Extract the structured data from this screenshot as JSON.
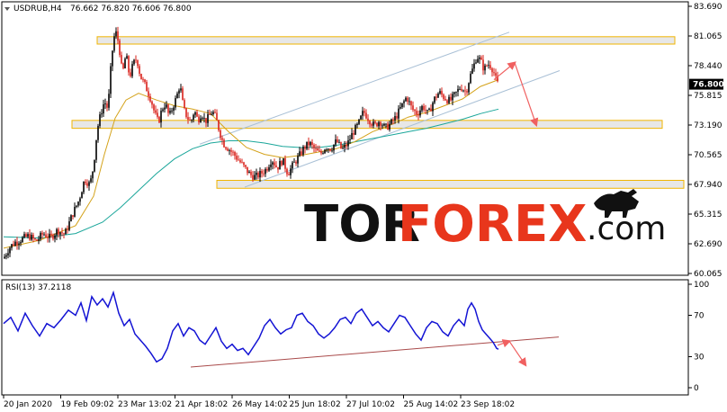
{
  "chart_data": [
    {
      "type": "candlestick",
      "title": "USDRUB,H4  76.662 76.820 76.606 76.800",
      "symbol": "USDRUB,H4",
      "ohlc_header": "76.662 76.820 76.606 76.800",
      "last_price_label": "76.800",
      "ylim": [
        60.065,
        83.69
      ],
      "y_ticks": [
        "83.690",
        "81.065",
        "78.440",
        "75.815",
        "73.190",
        "70.565",
        "67.940",
        "65.315",
        "62.690",
        "60.065"
      ],
      "x_tick_labels": [
        "20 Jan 2020",
        "19 Feb 09:02",
        "23 Mar 13:02",
        "21 Apr 18:02",
        "26 May 14:02",
        "25 Jun 18:02",
        "27 Jul 10:02",
        "25 Aug 14:02",
        "23 Sep 18:02"
      ],
      "close_path": [
        [
          0,
          61.4
        ],
        [
          6,
          62.3
        ],
        [
          12,
          62.8
        ],
        [
          20,
          63.1
        ],
        [
          28,
          63.4
        ],
        [
          36,
          62.9
        ],
        [
          44,
          63.6
        ],
        [
          52,
          63.2
        ],
        [
          60,
          63.9
        ],
        [
          68,
          63.5
        ],
        [
          76,
          65.2
        ],
        [
          84,
          66.6
        ],
        [
          90,
          68.4
        ],
        [
          96,
          67.9
        ],
        [
          100,
          69.6
        ],
        [
          104,
          72.8
        ],
        [
          108,
          74.2
        ],
        [
          112,
          75.3
        ],
        [
          116,
          74.6
        ],
        [
          120,
          79.2
        ],
        [
          124,
          81.6
        ],
        [
          128,
          80.4
        ],
        [
          132,
          77.6
        ],
        [
          136,
          79.5
        ],
        [
          140,
          77.4
        ],
        [
          144,
          78.6
        ],
        [
          148,
          79.1
        ],
        [
          152,
          77.5
        ],
        [
          156,
          76.9
        ],
        [
          160,
          76.2
        ],
        [
          164,
          75.4
        ],
        [
          168,
          74.2
        ],
        [
          172,
          73.4
        ],
        [
          176,
          74.6
        ],
        [
          180,
          75.1
        ],
        [
          184,
          73.9
        ],
        [
          188,
          74.8
        ],
        [
          192,
          75.6
        ],
        [
          196,
          76.8
        ],
        [
          200,
          74.6
        ],
        [
          204,
          73.9
        ],
        [
          208,
          73.4
        ],
        [
          212,
          74.5
        ],
        [
          216,
          73.6
        ],
        [
          220,
          74.3
        ],
        [
          224,
          73.5
        ],
        [
          228,
          73.9
        ],
        [
          232,
          74.4
        ],
        [
          236,
          73.8
        ],
        [
          240,
          72.6
        ],
        [
          244,
          71.6
        ],
        [
          250,
          71.1
        ],
        [
          256,
          70.6
        ],
        [
          262,
          70.0
        ],
        [
          268,
          69.4
        ],
        [
          274,
          68.8
        ],
        [
          280,
          68.6
        ],
        [
          286,
          68.9
        ],
        [
          292,
          69.3
        ],
        [
          298,
          70.2
        ],
        [
          304,
          69.4
        ],
        [
          310,
          70.1
        ],
        [
          316,
          68.9
        ],
        [
          322,
          69.7
        ],
        [
          328,
          70.4
        ],
        [
          334,
          71.2
        ],
        [
          340,
          71.6
        ],
        [
          346,
          71.0
        ],
        [
          352,
          70.6
        ],
        [
          358,
          71.3
        ],
        [
          364,
          71.1
        ],
        [
          370,
          71.8
        ],
        [
          376,
          71.0
        ],
        [
          382,
          71.5
        ],
        [
          388,
          72.5
        ],
        [
          394,
          73.2
        ],
        [
          400,
          74.4
        ],
        [
          406,
          73.7
        ],
        [
          412,
          73.1
        ],
        [
          418,
          73.6
        ],
        [
          424,
          72.9
        ],
        [
          430,
          73.3
        ],
        [
          436,
          73.9
        ],
        [
          442,
          74.8
        ],
        [
          448,
          75.7
        ],
        [
          454,
          74.6
        ],
        [
          460,
          74.2
        ],
        [
          466,
          74.9
        ],
        [
          472,
          74.1
        ],
        [
          478,
          75.4
        ],
        [
          484,
          76.1
        ],
        [
          490,
          75.6
        ],
        [
          496,
          75.3
        ],
        [
          502,
          75.9
        ],
        [
          508,
          76.6
        ],
        [
          514,
          76.1
        ],
        [
          518,
          77.4
        ],
        [
          522,
          78.3
        ],
        [
          526,
          79.3
        ],
        [
          530,
          78.9
        ],
        [
          534,
          78.1
        ],
        [
          538,
          78.6
        ],
        [
          542,
          78.4
        ],
        [
          546,
          77.6
        ],
        [
          548,
          76.9
        ],
        [
          550,
          76.8
        ]
      ],
      "ma_fast": [
        [
          0,
          62.3
        ],
        [
          40,
          63.0
        ],
        [
          80,
          64.3
        ],
        [
          100,
          66.9
        ],
        [
          112,
          70.6
        ],
        [
          124,
          73.8
        ],
        [
          136,
          75.4
        ],
        [
          150,
          76.0
        ],
        [
          170,
          75.4
        ],
        [
          190,
          74.9
        ],
        [
          210,
          74.6
        ],
        [
          230,
          74.2
        ],
        [
          250,
          72.6
        ],
        [
          270,
          71.2
        ],
        [
          290,
          70.6
        ],
        [
          310,
          70.3
        ],
        [
          330,
          70.5
        ],
        [
          350,
          70.8
        ],
        [
          370,
          71.1
        ],
        [
          390,
          71.7
        ],
        [
          410,
          72.6
        ],
        [
          430,
          73.2
        ],
        [
          450,
          73.9
        ],
        [
          470,
          74.3
        ],
        [
          490,
          74.9
        ],
        [
          510,
          75.5
        ],
        [
          530,
          76.6
        ],
        [
          550,
          77.2
        ]
      ],
      "ma_slow": [
        [
          0,
          63.3
        ],
        [
          40,
          63.2
        ],
        [
          80,
          63.6
        ],
        [
          110,
          64.6
        ],
        [
          130,
          65.9
        ],
        [
          150,
          67.4
        ],
        [
          170,
          68.9
        ],
        [
          190,
          70.2
        ],
        [
          210,
          71.1
        ],
        [
          230,
          71.6
        ],
        [
          250,
          71.8
        ],
        [
          270,
          71.8
        ],
        [
          290,
          71.6
        ],
        [
          310,
          71.3
        ],
        [
          330,
          71.2
        ],
        [
          350,
          71.2
        ],
        [
          370,
          71.4
        ],
        [
          390,
          71.7
        ],
        [
          410,
          72.0
        ],
        [
          430,
          72.3
        ],
        [
          450,
          72.6
        ],
        [
          470,
          72.9
        ],
        [
          490,
          73.3
        ],
        [
          510,
          73.7
        ],
        [
          530,
          74.2
        ],
        [
          550,
          74.6
        ]
      ],
      "zones": [
        {
          "from": 80.35,
          "to": 81.0,
          "x_start": 104,
          "x_end": 746
        },
        {
          "from": 72.9,
          "to": 73.6,
          "x_start": 76,
          "x_end": 732
        },
        {
          "from": 67.6,
          "to": 68.3,
          "x_start": 237,
          "x_end": 756
        }
      ],
      "channel_lines": [
        {
          "x1": 218,
          "y1": 71.5,
          "x2": 562,
          "y2": 81.4
        },
        {
          "x1": 268,
          "y1": 67.7,
          "x2": 618,
          "y2": 78.0
        }
      ],
      "forecast_arrows": [
        {
          "x1": 545,
          "y1": 77.2,
          "x2": 568,
          "y2": 78.7
        },
        {
          "x1": 568,
          "y1": 78.7,
          "x2": 592,
          "y2": 73.2
        }
      ]
    },
    {
      "type": "line",
      "title": "RSI(13) 37.2118",
      "indicator": "RSI(13)",
      "value_label": "37.2118",
      "ylim": [
        0,
        100
      ],
      "y_ticks": [
        "100",
        "70",
        "30",
        "0"
      ],
      "values": [
        [
          0,
          62
        ],
        [
          8,
          68
        ],
        [
          16,
          55
        ],
        [
          24,
          72
        ],
        [
          32,
          60
        ],
        [
          40,
          50
        ],
        [
          48,
          62
        ],
        [
          56,
          58
        ],
        [
          64,
          66
        ],
        [
          72,
          75
        ],
        [
          80,
          70
        ],
        [
          86,
          82
        ],
        [
          92,
          65
        ],
        [
          98,
          88
        ],
        [
          104,
          80
        ],
        [
          110,
          86
        ],
        [
          116,
          78
        ],
        [
          122,
          92
        ],
        [
          128,
          72
        ],
        [
          134,
          60
        ],
        [
          140,
          66
        ],
        [
          146,
          52
        ],
        [
          152,
          46
        ],
        [
          158,
          40
        ],
        [
          164,
          33
        ],
        [
          170,
          25
        ],
        [
          176,
          28
        ],
        [
          182,
          38
        ],
        [
          188,
          55
        ],
        [
          194,
          62
        ],
        [
          200,
          50
        ],
        [
          206,
          58
        ],
        [
          212,
          55
        ],
        [
          218,
          46
        ],
        [
          224,
          42
        ],
        [
          230,
          50
        ],
        [
          236,
          58
        ],
        [
          242,
          45
        ],
        [
          248,
          38
        ],
        [
          254,
          42
        ],
        [
          260,
          36
        ],
        [
          266,
          38
        ],
        [
          272,
          32
        ],
        [
          278,
          40
        ],
        [
          284,
          48
        ],
        [
          290,
          60
        ],
        [
          296,
          66
        ],
        [
          302,
          58
        ],
        [
          308,
          52
        ],
        [
          314,
          56
        ],
        [
          320,
          58
        ],
        [
          326,
          70
        ],
        [
          332,
          72
        ],
        [
          338,
          64
        ],
        [
          344,
          60
        ],
        [
          350,
          52
        ],
        [
          356,
          48
        ],
        [
          362,
          52
        ],
        [
          368,
          58
        ],
        [
          374,
          66
        ],
        [
          380,
          68
        ],
        [
          386,
          62
        ],
        [
          392,
          72
        ],
        [
          398,
          76
        ],
        [
          404,
          68
        ],
        [
          410,
          60
        ],
        [
          416,
          64
        ],
        [
          422,
          58
        ],
        [
          428,
          54
        ],
        [
          434,
          62
        ],
        [
          440,
          70
        ],
        [
          446,
          68
        ],
        [
          452,
          60
        ],
        [
          458,
          52
        ],
        [
          464,
          46
        ],
        [
          470,
          58
        ],
        [
          476,
          64
        ],
        [
          482,
          62
        ],
        [
          488,
          54
        ],
        [
          494,
          50
        ],
        [
          500,
          60
        ],
        [
          506,
          66
        ],
        [
          512,
          60
        ],
        [
          516,
          76
        ],
        [
          520,
          82
        ],
        [
          524,
          76
        ],
        [
          528,
          64
        ],
        [
          532,
          56
        ],
        [
          536,
          52
        ],
        [
          540,
          48
        ],
        [
          544,
          44
        ],
        [
          548,
          38
        ],
        [
          550,
          37.2
        ]
      ],
      "trend_line": {
        "x1": 208,
        "y1": 20,
        "x2": 617,
        "y2": 49
      },
      "forecast_arrows": [
        {
          "x1": 549,
          "y1": 41,
          "x2": 562,
          "y2": 45
        },
        {
          "x1": 562,
          "y1": 45,
          "x2": 580,
          "y2": 22
        }
      ]
    }
  ],
  "watermark": {
    "part1": "TOR",
    "part2": "FOREX",
    "part3": ".com"
  },
  "colors": {
    "bull_candle": "#000000",
    "bear_candle": "#d9201a",
    "ma_fast": "#d4a21a",
    "ma_slow": "#1aa69a",
    "rsi": "#1414d4",
    "zone_fill": "#e3e3e3",
    "zone_border": "#f0b400",
    "channel": "#a9c0d6",
    "forecast_arrow": "#f06060",
    "rsi_trend": "#a94a4a",
    "last_price_bg": "#000000",
    "logo_dark": "#111111",
    "logo_red": "#e8361c"
  }
}
